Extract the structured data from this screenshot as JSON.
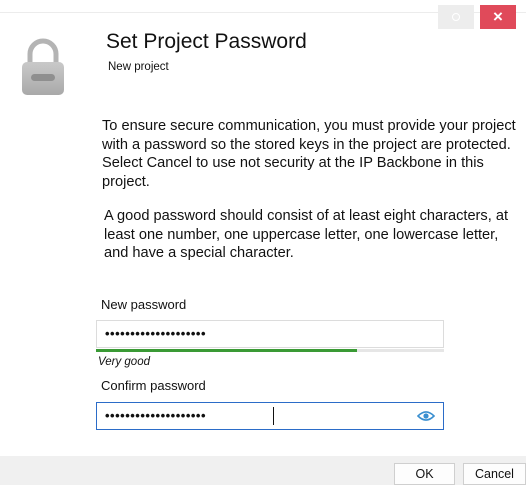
{
  "window": {
    "restore_icon": "restore-icon",
    "close_icon": "close-icon",
    "close_label": "×"
  },
  "header": {
    "icon": "lock-icon",
    "title": "Set Project Password",
    "subtitle": "New project"
  },
  "body": {
    "paragraph1": "To ensure secure communication, you must provide your project with a password so the stored keys in the project are protected. Select Cancel to use not security at the IP Backbone in this project.",
    "paragraph2": "A good password should consist of at least eight characters, at least one number, one uppercase letter, one lowercase letter, and have a special character."
  },
  "form": {
    "new_password_label": "New password",
    "new_password_value": "••••••••••••••••••••",
    "strength_label": "Very good",
    "strength_fraction": 0.75,
    "strength_color": "#3a9a35",
    "confirm_password_label": "Confirm password",
    "confirm_password_value": "••••••••••••••••••••",
    "reveal_icon": "eye-icon"
  },
  "buttons": {
    "ok": "OK",
    "cancel": "Cancel"
  },
  "colors": {
    "close_button": "#e04a5a",
    "focus_border": "#2b6cc8",
    "accent": "#3a8fd0"
  }
}
